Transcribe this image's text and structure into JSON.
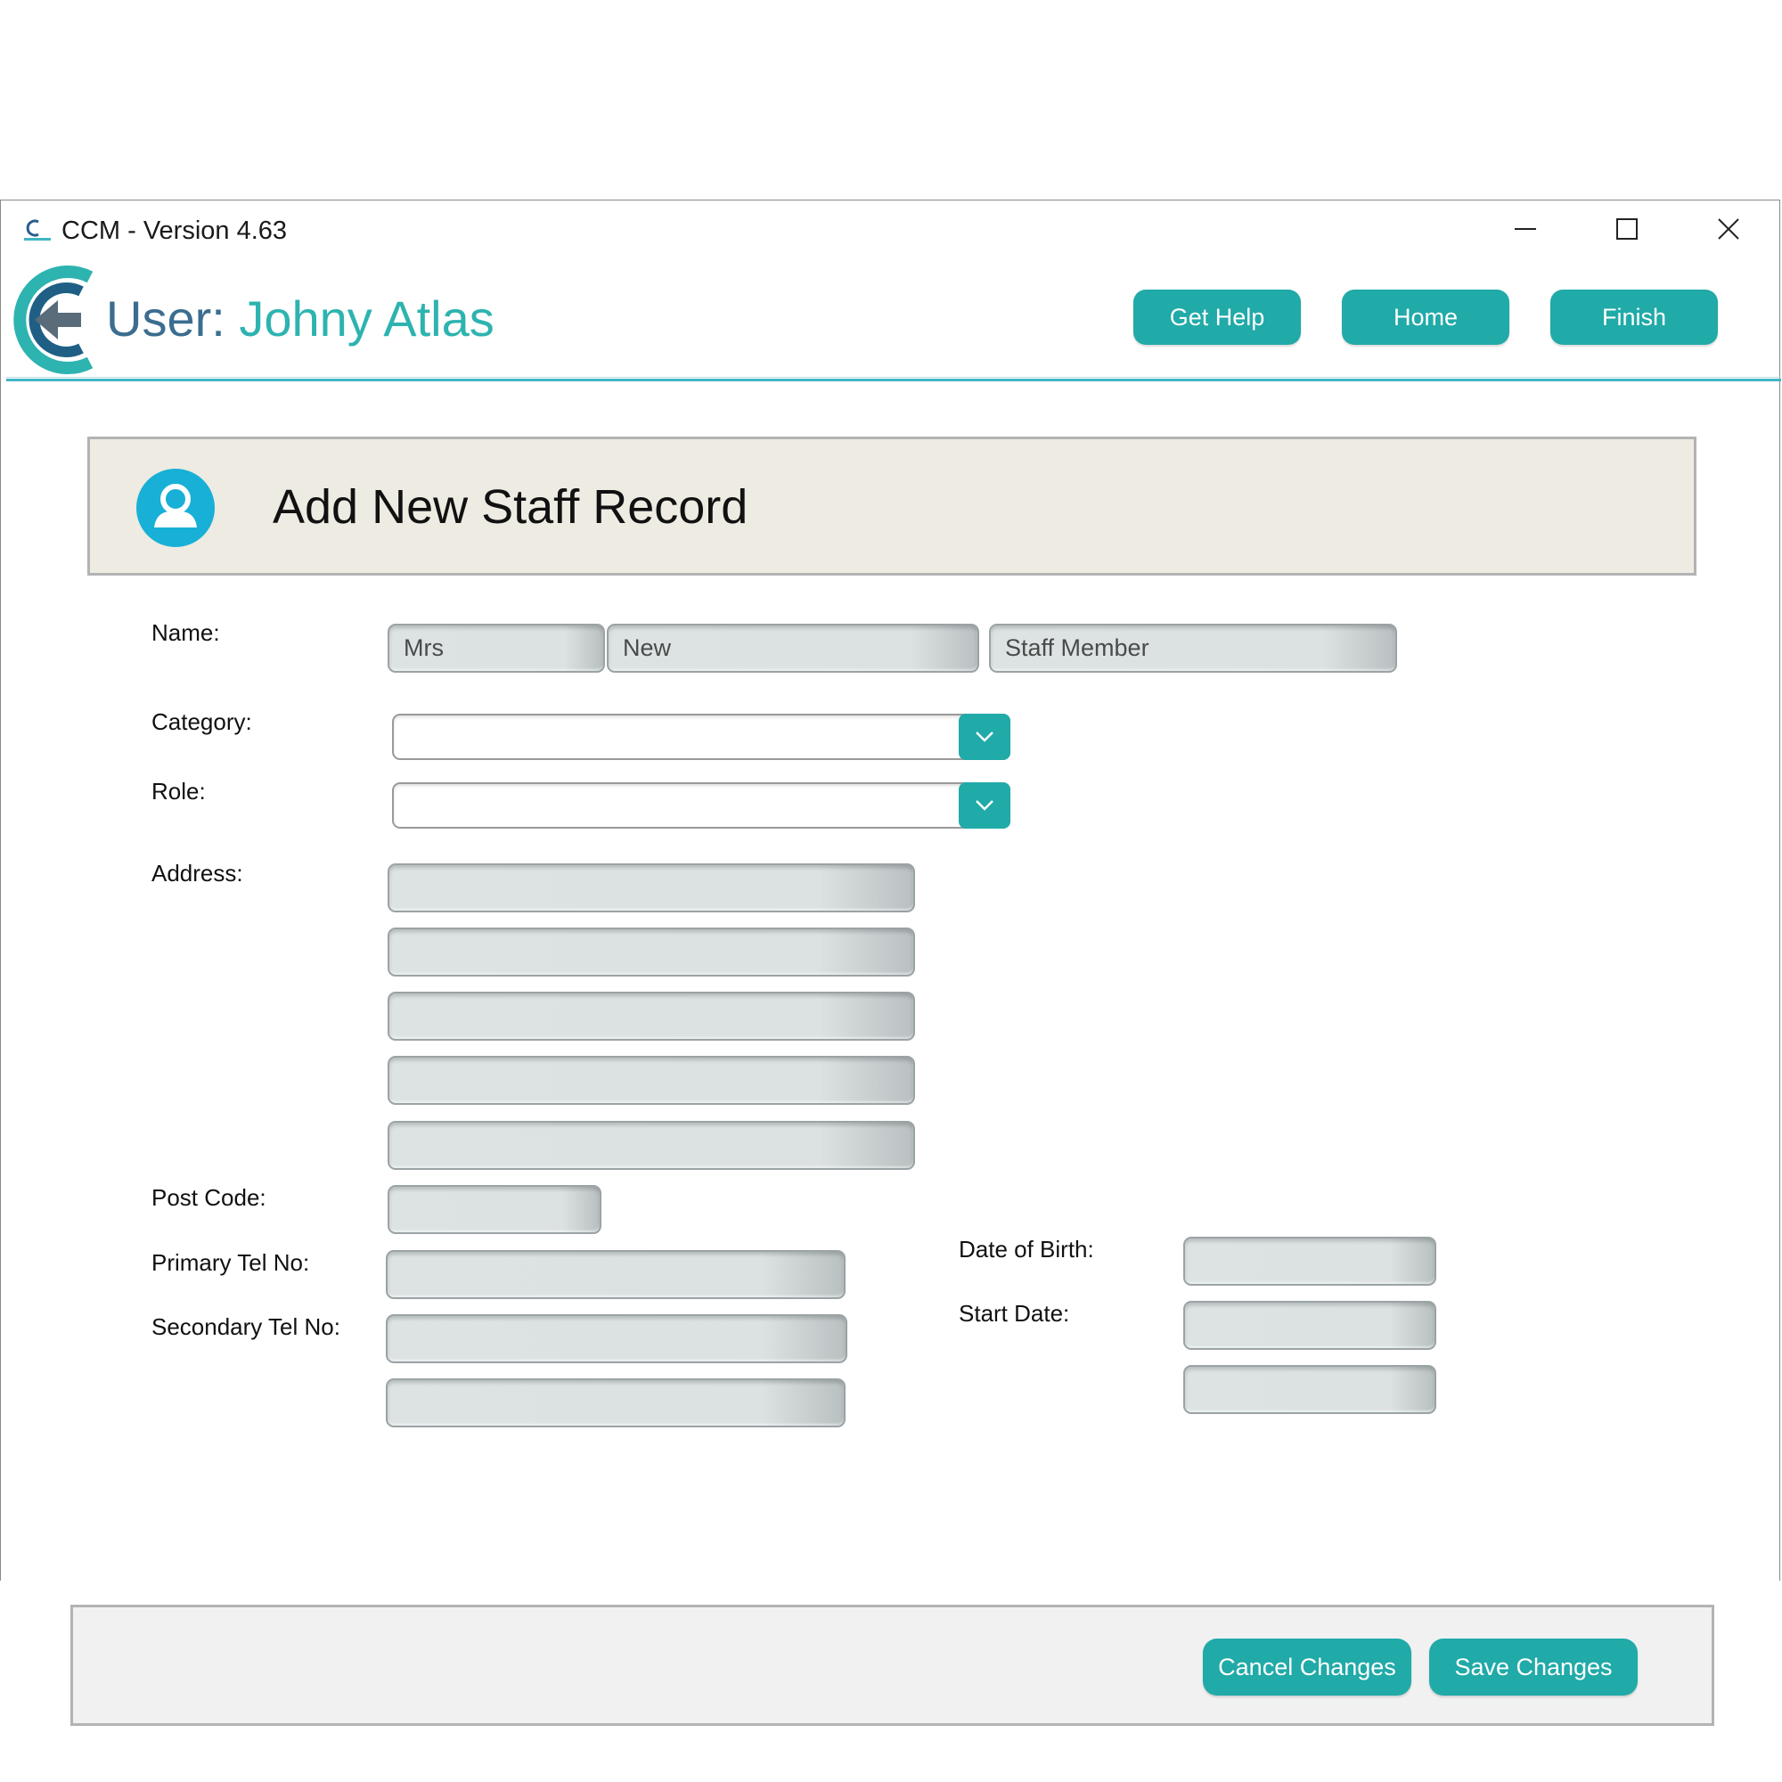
{
  "window": {
    "title": "CCM - Version 4.63"
  },
  "header": {
    "user_prefix": "User:",
    "user_name": "Johny Atlas",
    "buttons": {
      "get_help": "Get Help",
      "home": "Home",
      "finish": "Finish"
    }
  },
  "record": {
    "title": "Add New Staff Record"
  },
  "form": {
    "name": {
      "label": "Name:",
      "title_value": "Mrs",
      "first_value": "New",
      "last_value": "Staff Member"
    },
    "category": {
      "label": "Category:",
      "value": ""
    },
    "role": {
      "label": "Role:",
      "value": ""
    },
    "address": {
      "label": "Address:",
      "lines": [
        "",
        "",
        "",
        "",
        ""
      ]
    },
    "post_code": {
      "label": "Post Code:",
      "value": ""
    },
    "primary_tel": {
      "label": "Primary Tel No:",
      "value": ""
    },
    "secondary_tel": {
      "label": "Secondary Tel No:",
      "value": ""
    },
    "date_of_birth": {
      "label": "Date of Birth:",
      "value": ""
    },
    "start_date": {
      "label": "Start Date:",
      "value": ""
    }
  },
  "footer": {
    "cancel_label": "Cancel Changes",
    "save_label": "Save Changes"
  },
  "colors": {
    "accent": "#20aaa8",
    "user_label": "#3b6d8f",
    "panel_bg": "#edebe2"
  }
}
